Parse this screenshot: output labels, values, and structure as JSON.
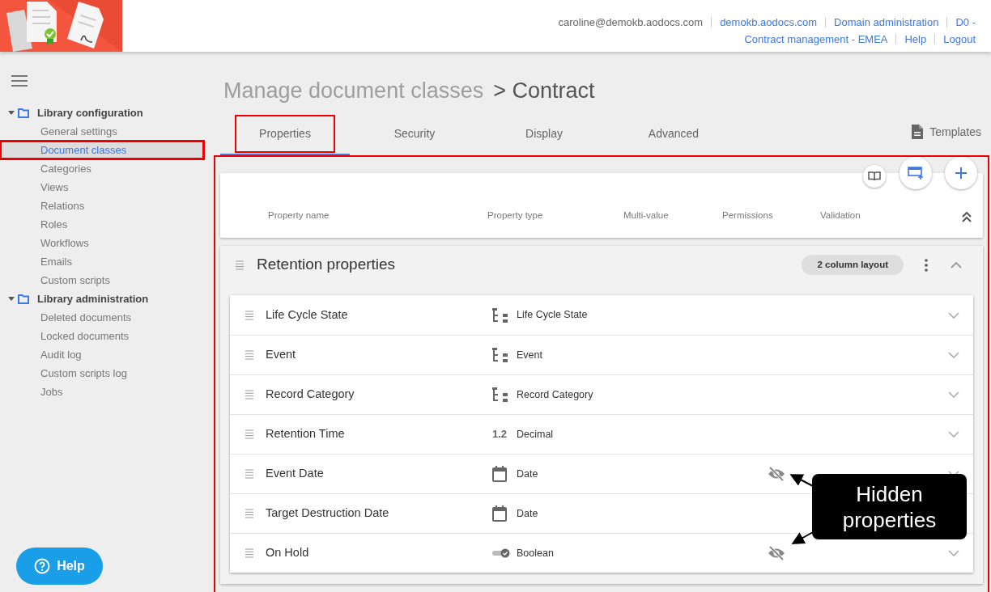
{
  "header": {
    "user": "caroline@demokb.aodocs.com",
    "links_line_1": [
      "demokb.aodocs.com",
      "Domain administration",
      "D0 -"
    ],
    "links_line_2": [
      "Contract management - EMEA",
      "Help",
      "Logout"
    ]
  },
  "sidebar": {
    "groups": [
      {
        "label": "Library configuration",
        "expanded": true,
        "items": [
          {
            "label": "General settings",
            "selected": false,
            "annotated": false
          },
          {
            "label": "Document classes",
            "selected": true,
            "annotated": true
          },
          {
            "label": "Categories",
            "selected": false,
            "annotated": false
          },
          {
            "label": "Views",
            "selected": false,
            "annotated": false
          },
          {
            "label": "Relations",
            "selected": false,
            "annotated": false
          },
          {
            "label": "Roles",
            "selected": false,
            "annotated": false
          },
          {
            "label": "Workflows",
            "selected": false,
            "annotated": false
          },
          {
            "label": "Emails",
            "selected": false,
            "annotated": false
          },
          {
            "label": "Custom scripts",
            "selected": false,
            "annotated": false
          }
        ]
      },
      {
        "label": "Library administration",
        "expanded": true,
        "items": [
          {
            "label": "Deleted documents",
            "selected": false,
            "annotated": false
          },
          {
            "label": "Locked documents",
            "selected": false,
            "annotated": false
          },
          {
            "label": "Audit log",
            "selected": false,
            "annotated": false
          },
          {
            "label": "Custom scripts log",
            "selected": false,
            "annotated": false
          },
          {
            "label": "Jobs",
            "selected": false,
            "annotated": false
          }
        ]
      }
    ],
    "help_button": "Help"
  },
  "breadcrumb": {
    "parent": "Manage document classes",
    "current": "> Contract"
  },
  "tabs": [
    {
      "label": "Properties",
      "selected": true,
      "annotated": true
    },
    {
      "label": "Security",
      "selected": false,
      "annotated": false
    },
    {
      "label": "Display",
      "selected": false,
      "annotated": false
    },
    {
      "label": "Advanced",
      "selected": false,
      "annotated": false
    }
  ],
  "templates_button": "Templates",
  "panel": {
    "annotated": true,
    "columns": [
      "Property name",
      "Property type",
      "Multi-value",
      "Permissions",
      "Validation"
    ],
    "section": {
      "title": "Retention properties",
      "badge": "2 column layout",
      "expanded": true,
      "rows": [
        {
          "name": "Life Cycle State",
          "kind": "category",
          "type": "Life Cycle State",
          "hidden": false
        },
        {
          "name": "Event",
          "kind": "category",
          "type": "Event",
          "hidden": false
        },
        {
          "name": "Record Category",
          "kind": "category",
          "type": "Record Category",
          "hidden": false
        },
        {
          "name": "Retention Time",
          "kind": "decimal",
          "type_symbol": "1.2",
          "type": "Decimal",
          "hidden": false
        },
        {
          "name": "Event Date",
          "kind": "date",
          "type": "Date",
          "hidden": true
        },
        {
          "name": "Target Destruction Date",
          "kind": "date",
          "type": "Date",
          "hidden": false
        },
        {
          "name": "On Hold",
          "kind": "boolean",
          "type": "Boolean",
          "hidden": true
        }
      ]
    }
  },
  "callout": {
    "text": "Hidden properties"
  }
}
